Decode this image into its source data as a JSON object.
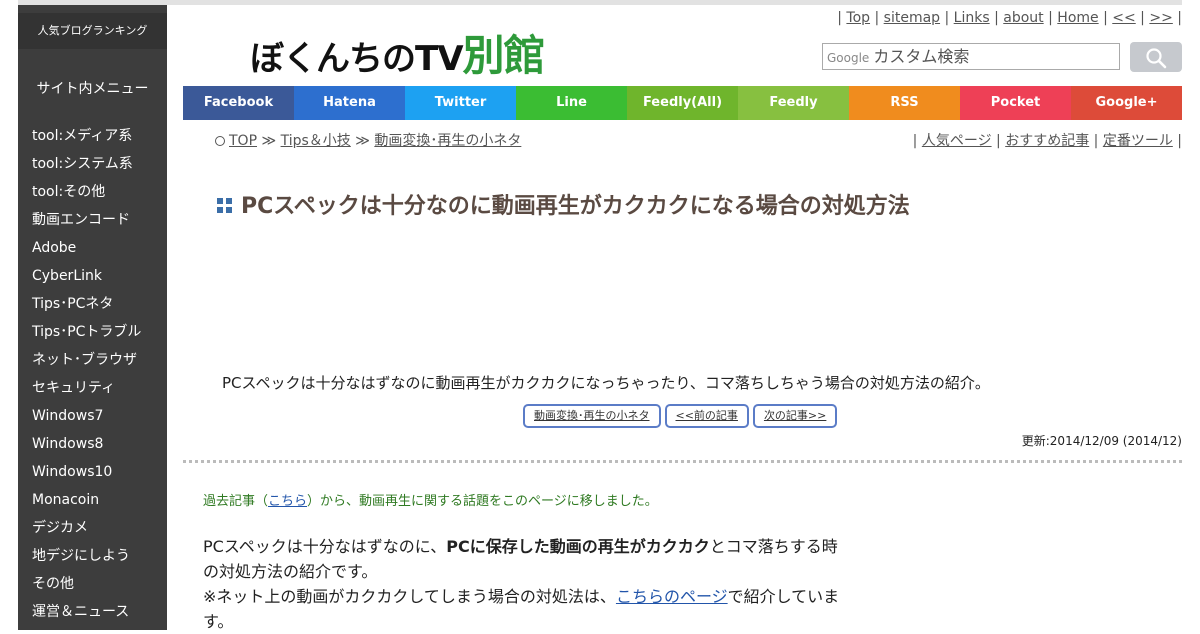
{
  "sidebar": {
    "ranking": "人気ブログランキング",
    "menu_title": "サイト内メニュー",
    "items": [
      {
        "label": "tool:メディア系"
      },
      {
        "label": "tool:システム系"
      },
      {
        "label": "tool:その他"
      },
      {
        "label": "動画エンコード"
      },
      {
        "label": "Adobe"
      },
      {
        "label": "CyberLink"
      },
      {
        "label": "Tips･PCネタ"
      },
      {
        "label": "Tips･PCトラブル"
      },
      {
        "label": "ネット･ブラウザ"
      },
      {
        "label": "セキュリティ"
      },
      {
        "label": "Windows7"
      },
      {
        "label": "Windows8"
      },
      {
        "label": "Windows10"
      },
      {
        "label": "Monacoin"
      },
      {
        "label": "デジカメ"
      },
      {
        "label": "地デジにしよう"
      },
      {
        "label": "その他"
      },
      {
        "label": "運営＆ニュース"
      }
    ]
  },
  "header": {
    "logo_main": "ぼくんちのTV",
    "logo_accent": "別館",
    "top_links": [
      "Top",
      "sitemap",
      "Links",
      "about",
      "Home",
      "<<",
      ">>"
    ],
    "search_google": "Google",
    "search_placeholder": "カスタム検索"
  },
  "share": [
    {
      "label": "Facebook",
      "color": "#3b5998"
    },
    {
      "label": "Hatena",
      "color": "#2d6fcf"
    },
    {
      "label": "Twitter",
      "color": "#1da1f2"
    },
    {
      "label": "Line",
      "color": "#3bbd33"
    },
    {
      "label": "Feedly(All)",
      "color": "#6fb52c"
    },
    {
      "label": "Feedly",
      "color": "#87c040"
    },
    {
      "label": "RSS",
      "color": "#f08c1e"
    },
    {
      "label": "Pocket",
      "color": "#ee4056"
    },
    {
      "label": "Google+",
      "color": "#dd4b39"
    }
  ],
  "breadcrumb": {
    "top": "TOP",
    "sep": "≫",
    "cat1": "Tips＆小技",
    "cat2": "動画変換･再生の小ネタ"
  },
  "right_links": [
    "人気ページ",
    "おすすめ記事",
    "定番ツール"
  ],
  "article": {
    "title": "PCスペックは十分なのに動画再生がカクカクになる場合の対処方法",
    "intro": "PCスペックは十分なはずなのに動画再生がカクカクになっちゃったり、コマ落ちしちゃう場合の対処方法の紹介。",
    "nav": [
      "動画変換･再生の小ネタ",
      "<<前の記事",
      "次の記事>>"
    ],
    "updated": "更新:2014/12/09 (2014/12)",
    "moved_pre": "過去記事（",
    "moved_link": "こちら",
    "moved_post": "）から、動画再生に関する話題をこのページに移しました。",
    "p1_pre": "PCスペックは十分なはずなのに、",
    "p1_bold": "PCに保存した動画の再生がカクカク",
    "p1_post": "とコマ落ちする時の対処方法の紹介です。",
    "p2_pre": "※ネット上の動画がカクカクしてしまう場合の対処法は、",
    "p2_link": "こちらのページ",
    "p2_post": "で紹介しています。"
  }
}
